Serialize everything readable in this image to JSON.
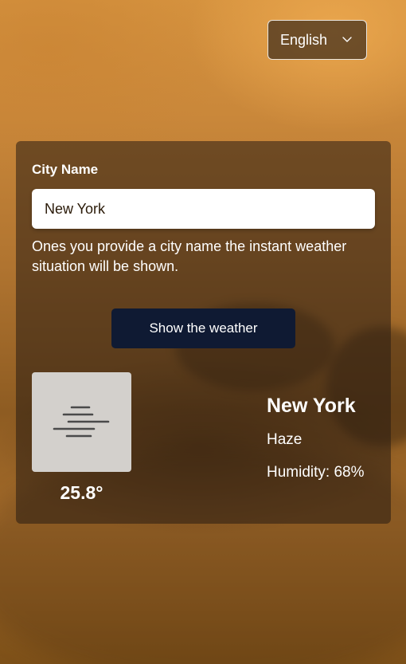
{
  "language_selector": {
    "selected": "English",
    "icon": "chevron-down-icon"
  },
  "form": {
    "label": "City Name",
    "city_value": "New York",
    "hint": "Ones you provide a city name the instant weather situation will be shown.",
    "button_label": "Show the weather"
  },
  "weather": {
    "icon": "haze-icon",
    "temperature": "25.8°",
    "city": "New York",
    "condition": "Haze",
    "humidity": "Humidity: 68%"
  },
  "colors": {
    "button_bg": "#0f1a33",
    "card_bg": "rgba(40,28,18,0.55)",
    "text": "#ffffff"
  }
}
